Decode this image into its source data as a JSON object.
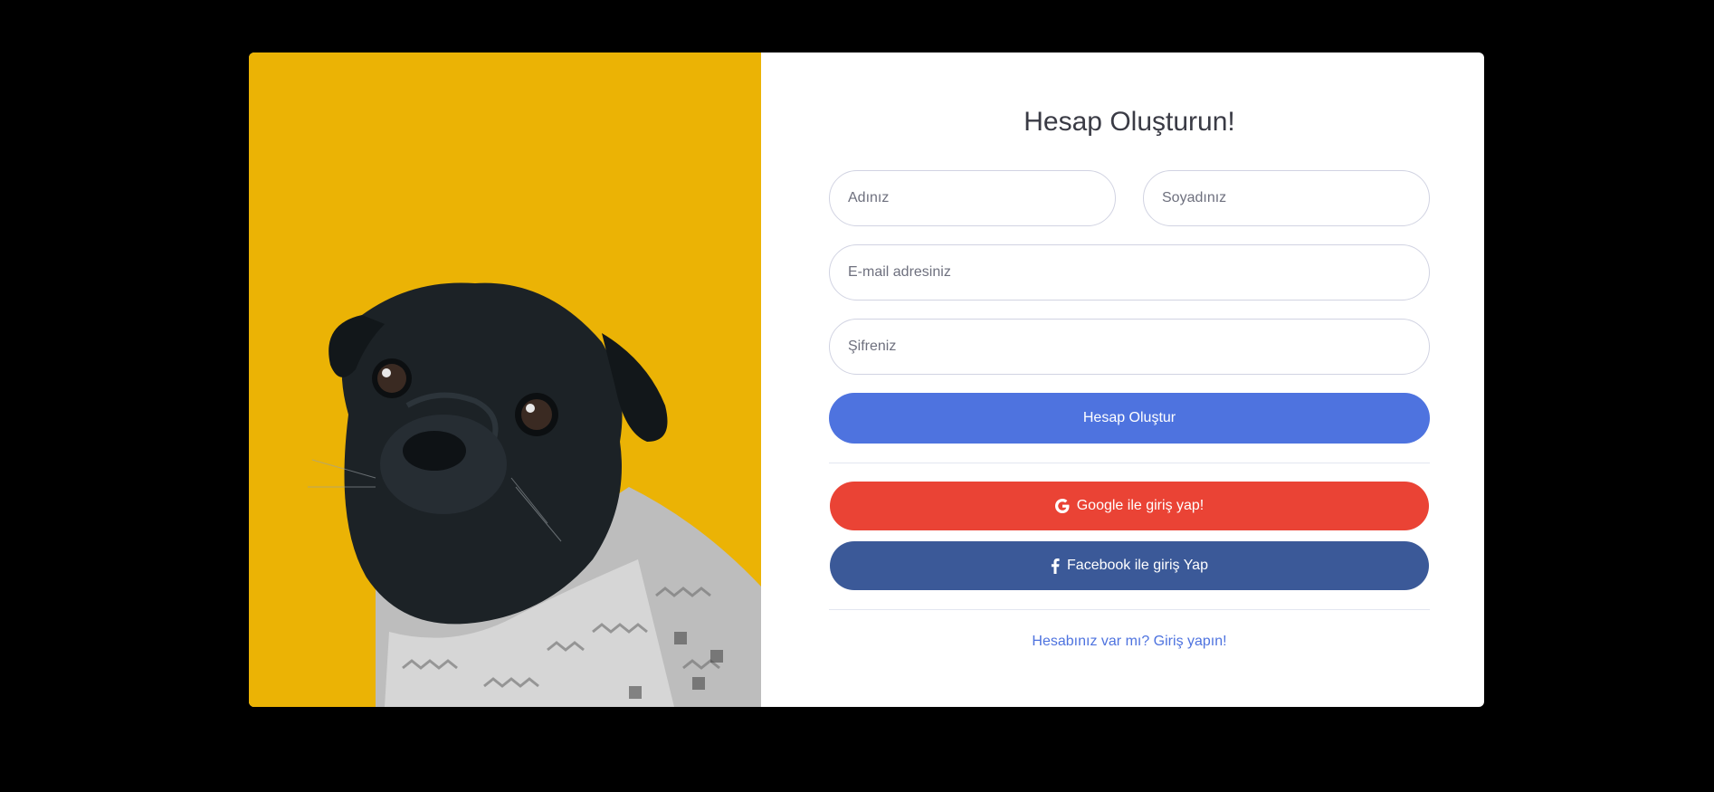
{
  "form": {
    "title": "Hesap Oluşturun!",
    "first_name_placeholder": "Adınız",
    "last_name_placeholder": "Soyadınız",
    "email_placeholder": "E-mail adresiniz",
    "password_placeholder": "Şifreniz",
    "submit_label": "Hesap Oluştur",
    "google_label": "Google ile giriş yap!",
    "facebook_label": "Facebook ile giriş Yap",
    "login_link": "Hesabınız var mı? Giriş yapın!"
  },
  "icons": {
    "google": "google-icon",
    "facebook": "facebook-icon"
  },
  "colors": {
    "image_background": "#ebb305",
    "primary": "#4e73df",
    "google": "#ea4335",
    "facebook": "#3b5998"
  }
}
